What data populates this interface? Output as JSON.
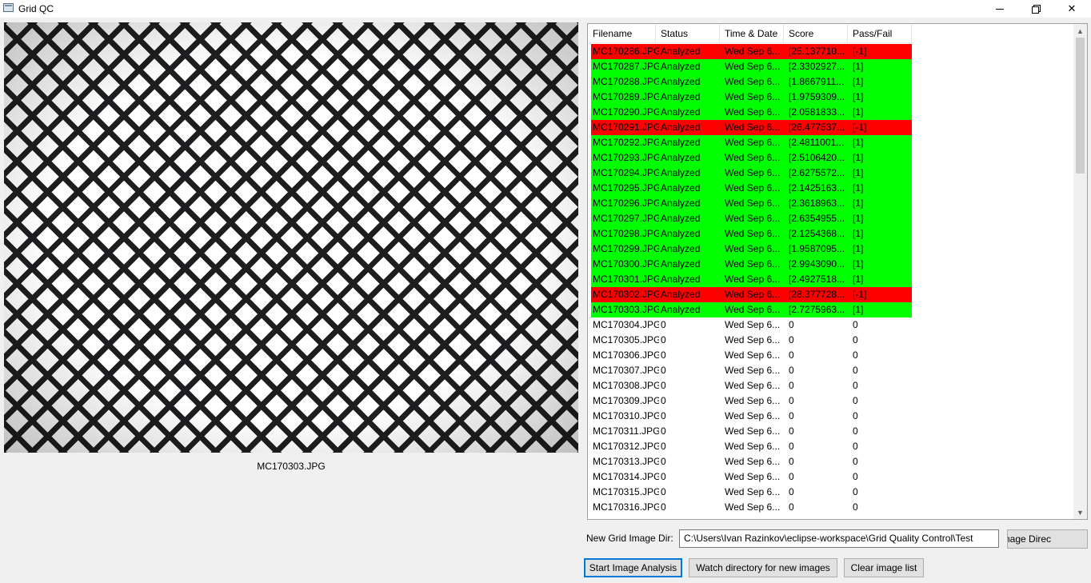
{
  "window": {
    "title": "Grid QC",
    "minimize_icon": "minimize-icon",
    "maximize_icon": "restore-icon",
    "close_glyph": "✕"
  },
  "preview": {
    "caption": "MC170303.JPG"
  },
  "table": {
    "headers": [
      "Filename",
      "Status",
      "Time & Date",
      "Score",
      "Pass/Fail"
    ],
    "colors": {
      "pass": "#00ff00",
      "fail": "#ff0000"
    },
    "rows": [
      {
        "filename": "MC170286.JPG",
        "status": "Analyzed",
        "time": "Wed Sep  6...",
        "score": "[25.137710...",
        "result": "[-1]",
        "state": "fail"
      },
      {
        "filename": "MC170287.JPG",
        "status": "Analyzed",
        "time": "Wed Sep  6...",
        "score": "[2.3302927...",
        "result": "[1]",
        "state": "pass"
      },
      {
        "filename": "MC170288.JPG",
        "status": "Analyzed",
        "time": "Wed Sep  6...",
        "score": "[1.8667911...",
        "result": "[1]",
        "state": "pass"
      },
      {
        "filename": "MC170289.JPG",
        "status": "Analyzed",
        "time": "Wed Sep  6...",
        "score": "[1.9759309...",
        "result": "[1]",
        "state": "pass"
      },
      {
        "filename": "MC170290.JPG",
        "status": "Analyzed",
        "time": "Wed Sep  6...",
        "score": "[2.0581833...",
        "result": "[1]",
        "state": "pass"
      },
      {
        "filename": "MC170291.JPG",
        "status": "Analyzed",
        "time": "Wed Sep  6...",
        "score": "[26.477537...",
        "result": "[-1]",
        "state": "fail"
      },
      {
        "filename": "MC170292.JPG",
        "status": "Analyzed",
        "time": "Wed Sep  6...",
        "score": "[2.4811001...",
        "result": "[1]",
        "state": "pass"
      },
      {
        "filename": "MC170293.JPG",
        "status": "Analyzed",
        "time": "Wed Sep  6...",
        "score": "[2.5106420...",
        "result": "[1]",
        "state": "pass"
      },
      {
        "filename": "MC170294.JPG",
        "status": "Analyzed",
        "time": "Wed Sep  6...",
        "score": "[2.6275572...",
        "result": "[1]",
        "state": "pass"
      },
      {
        "filename": "MC170295.JPG",
        "status": "Analyzed",
        "time": "Wed Sep  6...",
        "score": "[2.1425163...",
        "result": "[1]",
        "state": "pass"
      },
      {
        "filename": "MC170296.JPG",
        "status": "Analyzed",
        "time": "Wed Sep  6...",
        "score": "[2.3618963...",
        "result": "[1]",
        "state": "pass"
      },
      {
        "filename": "MC170297.JPG",
        "status": "Analyzed",
        "time": "Wed Sep  6...",
        "score": "[2.6354955...",
        "result": "[1]",
        "state": "pass"
      },
      {
        "filename": "MC170298.JPG",
        "status": "Analyzed",
        "time": "Wed Sep  6...",
        "score": "[2.1254368...",
        "result": "[1]",
        "state": "pass"
      },
      {
        "filename": "MC170299.JPG",
        "status": "Analyzed",
        "time": "Wed Sep  6...",
        "score": "[1.9587095...",
        "result": "[1]",
        "state": "pass"
      },
      {
        "filename": "MC170300.JPG",
        "status": "Analyzed",
        "time": "Wed Sep  6...",
        "score": "[2.9943090...",
        "result": "[1]",
        "state": "pass"
      },
      {
        "filename": "MC170301.JPG",
        "status": "Analyzed",
        "time": "Wed Sep  6...",
        "score": "[2.4927518...",
        "result": "[1]",
        "state": "pass"
      },
      {
        "filename": "MC170302.JPG",
        "status": "Analyzed",
        "time": "Wed Sep  6...",
        "score": "[28.377728...",
        "result": "[-1]",
        "state": "fail"
      },
      {
        "filename": "MC170303.JPG",
        "status": "Analyzed",
        "time": "Wed Sep  6...",
        "score": "[2.7275963...",
        "result": "[1]",
        "state": "pass"
      },
      {
        "filename": "MC170304.JPG",
        "status": "0",
        "time": "Wed Sep  6...",
        "score": "0",
        "result": "0",
        "state": "none"
      },
      {
        "filename": "MC170305.JPG",
        "status": "0",
        "time": "Wed Sep  6...",
        "score": "0",
        "result": "0",
        "state": "none"
      },
      {
        "filename": "MC170306.JPG",
        "status": "0",
        "time": "Wed Sep  6...",
        "score": "0",
        "result": "0",
        "state": "none"
      },
      {
        "filename": "MC170307.JPG",
        "status": "0",
        "time": "Wed Sep  6...",
        "score": "0",
        "result": "0",
        "state": "none"
      },
      {
        "filename": "MC170308.JPG",
        "status": "0",
        "time": "Wed Sep  6...",
        "score": "0",
        "result": "0",
        "state": "none"
      },
      {
        "filename": "MC170309.JPG",
        "status": "0",
        "time": "Wed Sep  6...",
        "score": "0",
        "result": "0",
        "state": "none"
      },
      {
        "filename": "MC170310.JPG",
        "status": "0",
        "time": "Wed Sep  6...",
        "score": "0",
        "result": "0",
        "state": "none"
      },
      {
        "filename": "MC170311.JPG",
        "status": "0",
        "time": "Wed Sep  6...",
        "score": "0",
        "result": "0",
        "state": "none"
      },
      {
        "filename": "MC170312.JPG",
        "status": "0",
        "time": "Wed Sep  6...",
        "score": "0",
        "result": "0",
        "state": "none"
      },
      {
        "filename": "MC170313.JPG",
        "status": "0",
        "time": "Wed Sep  6...",
        "score": "0",
        "result": "0",
        "state": "none"
      },
      {
        "filename": "MC170314.JPG",
        "status": "0",
        "time": "Wed Sep  6...",
        "score": "0",
        "result": "0",
        "state": "none"
      },
      {
        "filename": "MC170315.JPG",
        "status": "0",
        "time": "Wed Sep  6...",
        "score": "0",
        "result": "0",
        "state": "none"
      },
      {
        "filename": "MC170316.JPG",
        "status": "0",
        "time": "Wed Sep  6...",
        "score": "0",
        "result": "0",
        "state": "none"
      }
    ]
  },
  "scrollbar": {
    "up_glyph": "▲",
    "down_glyph": "▼"
  },
  "controls": {
    "dir_label": "New Grid Image Dir:",
    "dir_value": "C:\\Users\\Ivan Razinkov\\eclipse-workspace\\Grid Quality Control\\Test",
    "dir_button": "v Grid Image Direc",
    "start_button": "Start Image Analysis",
    "watch_button": "Watch directory for new images",
    "clear_button": "Clear image list"
  }
}
